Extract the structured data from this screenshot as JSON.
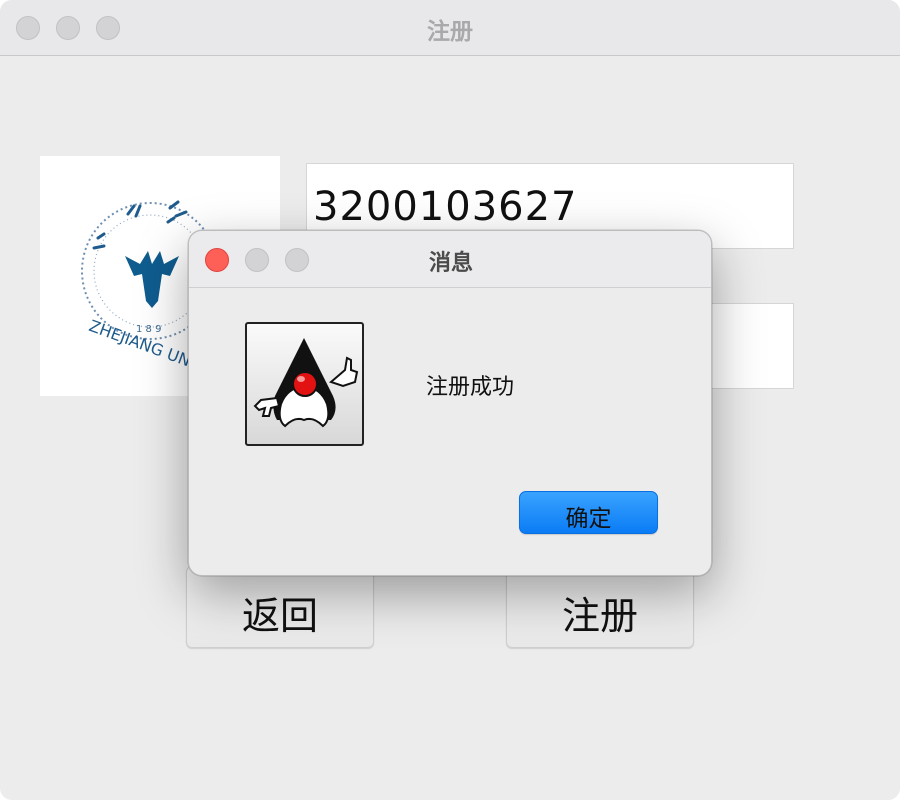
{
  "window": {
    "title": "注册"
  },
  "form": {
    "id_value": "3200103627",
    "second_value": ""
  },
  "buttons": {
    "back_label": "返回",
    "register_label": "注册"
  },
  "dialog": {
    "title": "消息",
    "message": "注册成功",
    "ok_label": "确定",
    "icon": "java-duke-icon"
  },
  "logo": {
    "icon": "zhejiang-university-logo",
    "text": "ZHEJIANG UNIVERSITY 1897"
  },
  "colors": {
    "accent": "#0a7cf5",
    "close_red": "#fe5f57",
    "window_bg": "#ececec"
  }
}
